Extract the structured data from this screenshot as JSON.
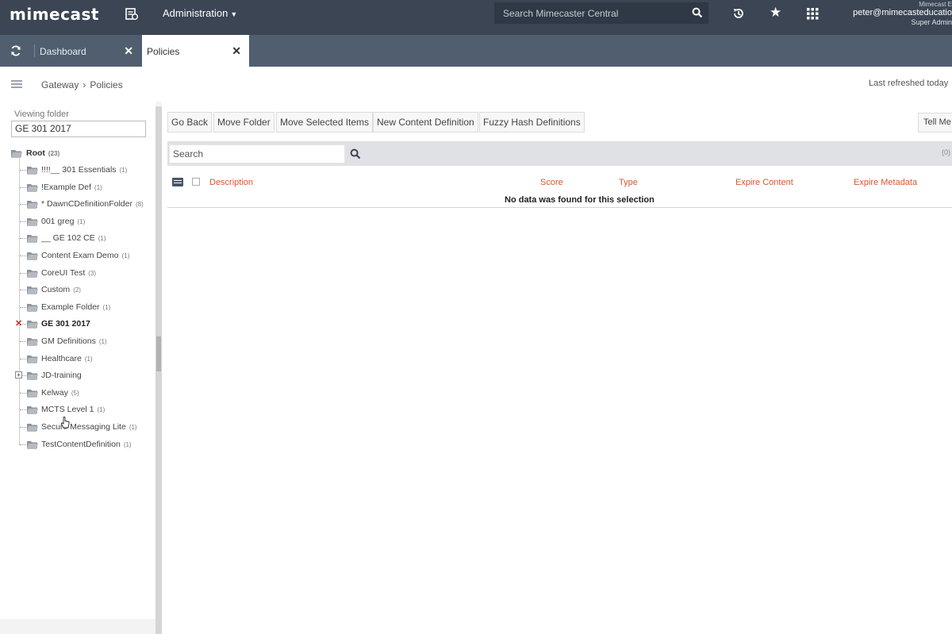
{
  "topbar": {
    "logo": "mimecast",
    "menu_label": "Administration",
    "search_placeholder": "Search Mimecaster Central",
    "account_name": "Mimecast E",
    "user_email": "peter@mimecasteducatio",
    "user_role": "Super Admin",
    "icons": [
      "navigation-icon",
      "search-icon",
      "history-icon",
      "star-icon",
      "apps-grid-icon"
    ]
  },
  "tabs": [
    {
      "label": "Dashboard"
    },
    {
      "label": "Policies"
    }
  ],
  "breadcrumb": {
    "items": [
      "Gateway",
      "Policies"
    ],
    "separator": "›",
    "last_refreshed": "Last refreshed today"
  },
  "folder_panel": {
    "viewing_folder_label": "Viewing folder",
    "viewing_folder_value": "GE 301 2017",
    "root": {
      "label": "Root",
      "count": "(23)"
    },
    "items": [
      {
        "label": "!!!!__ 301 Essentials",
        "count": "(1)"
      },
      {
        "label": "!Example Def",
        "count": "(1)"
      },
      {
        "label": "* DawnCDefinitionFolder",
        "count": "(8)"
      },
      {
        "label": "001 greg",
        "count": "(1)"
      },
      {
        "label": "__ GE 102 CE",
        "count": "(1)"
      },
      {
        "label": "Content Exam Demo",
        "count": "(1)"
      },
      {
        "label": "CoreUI Test",
        "count": "(3)"
      },
      {
        "label": "Custom",
        "count": "(2)"
      },
      {
        "label": "Example Folder",
        "count": "(1)"
      },
      {
        "label": "GE 301 2017",
        "count": ""
      },
      {
        "label": "GM Definitions",
        "count": "(1)"
      },
      {
        "label": "Healthcare",
        "count": "(1)"
      },
      {
        "label": "JD-training",
        "count": ""
      },
      {
        "label": "Kelway",
        "count": "(5)"
      },
      {
        "label": "MCTS Level 1",
        "count": "(1)"
      },
      {
        "label": "Secure Messaging Lite",
        "count": "(1)"
      },
      {
        "label": "TestContentDefinition",
        "count": "(1)"
      }
    ],
    "selected_folder": "GE 301 2017"
  },
  "toolbar": {
    "go_back": "Go Back",
    "move_folder": "Move Folder",
    "move_selected": "Move Selected Items",
    "new_content_definition": "New Content Definition",
    "fuzzy_hash": "Fuzzy Hash Definitions",
    "tell_me": "Tell Me"
  },
  "grid": {
    "search_placeholder": "Search",
    "columns": [
      "Description",
      "Score",
      "Type",
      "Expire Content",
      "Expire Metadata"
    ],
    "empty_message": "No data was found for this selection",
    "strip_right": "(0)"
  },
  "colors": {
    "topbar": "#3b4553",
    "tabbar": "#505e6f",
    "column_header": "#d9572e",
    "folder_icon": "#8e959c"
  }
}
